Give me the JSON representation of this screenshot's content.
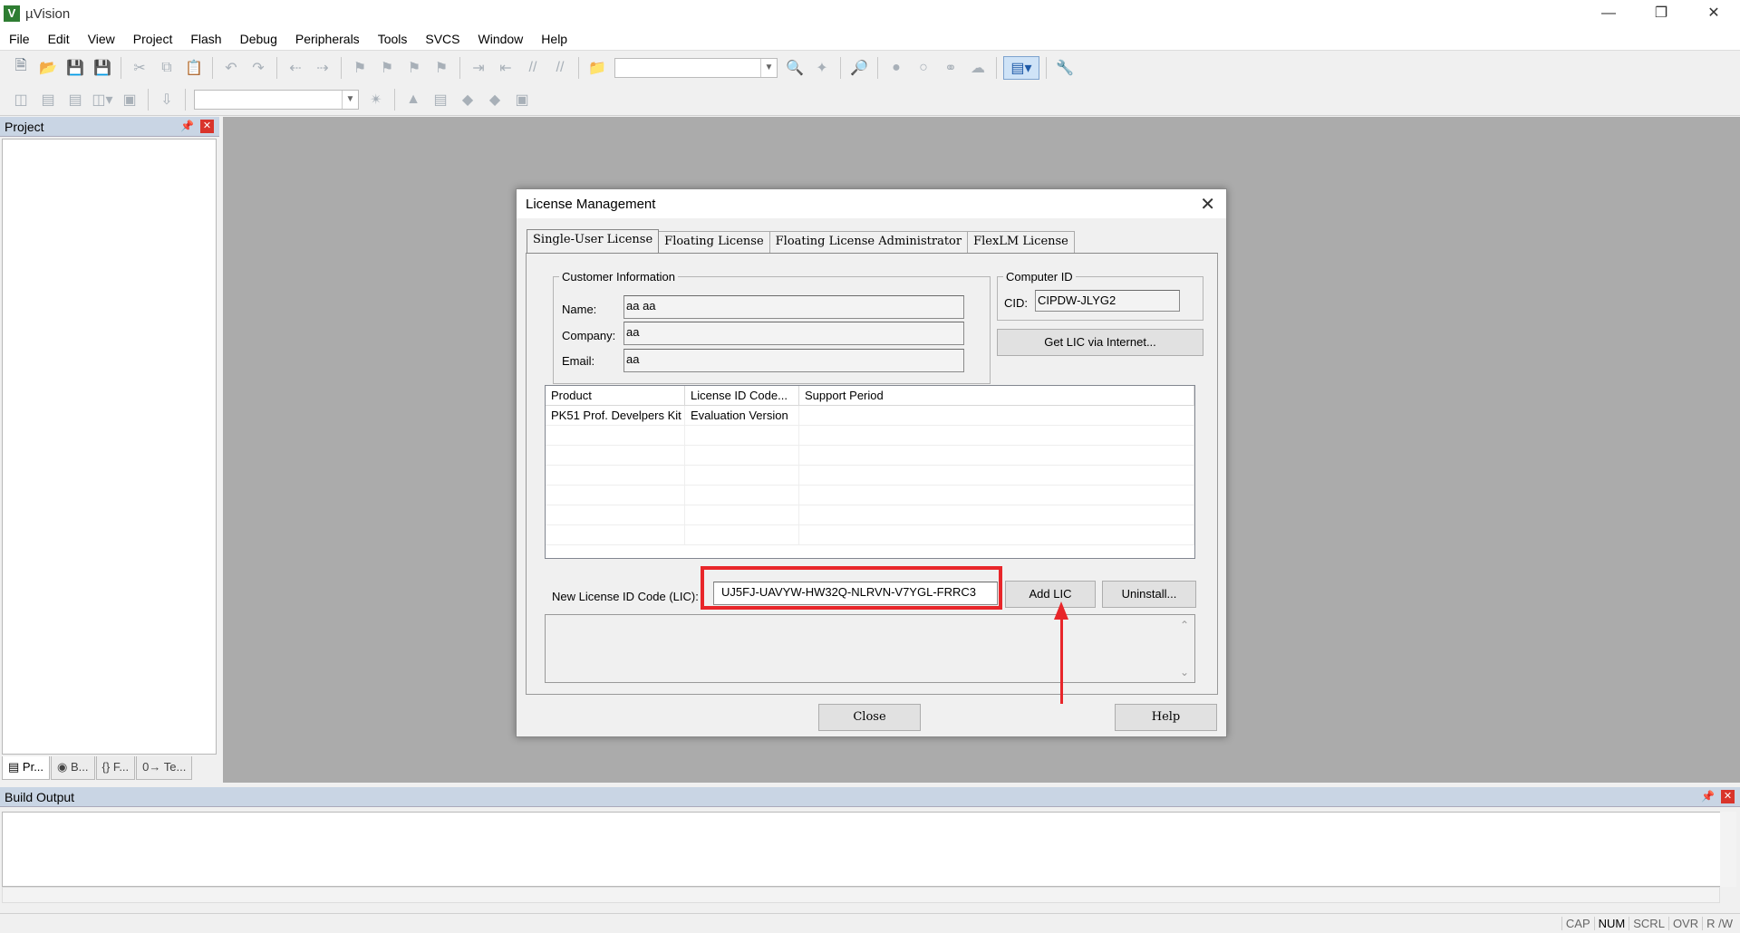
{
  "app": {
    "title": "µVision",
    "icon_label": "V"
  },
  "menu": [
    "File",
    "Edit",
    "View",
    "Project",
    "Flash",
    "Debug",
    "Peripherals",
    "Tools",
    "SVCS",
    "Window",
    "Help"
  ],
  "project_panel": {
    "title": "Project",
    "tabs": [
      "Pr...",
      "B...",
      "F...",
      "Te..."
    ]
  },
  "build_output": {
    "title": "Build Output"
  },
  "status_bar": {
    "cells": [
      "CAP",
      "NUM",
      "SCRL",
      "OVR",
      "R /W"
    ]
  },
  "dialog": {
    "title": "License Management",
    "tabs": [
      "Single-User License",
      "Floating License",
      "Floating License Administrator",
      "FlexLM License"
    ],
    "customer_info": {
      "legend": "Customer Information",
      "name_label": "Name:",
      "name_value": "aa aa",
      "company_label": "Company:",
      "company_value": "aa",
      "email_label": "Email:",
      "email_value": "aa"
    },
    "computer_id": {
      "legend": "Computer ID",
      "cid_label": "CID:",
      "cid_value": "CIPDW-JLYG2",
      "get_lic_button": "Get LIC via Internet..."
    },
    "products": {
      "columns": [
        "Product",
        "License ID Code...",
        "Support Period"
      ],
      "rows": [
        [
          "PK51 Prof. Develpers Kit",
          "Evaluation Version",
          ""
        ]
      ]
    },
    "new_lic": {
      "label": "New License ID Code (LIC):",
      "value": "UJ5FJ-UAVYW-HW32Q-NLRVN-V7YGL-FRRC3",
      "add_button": "Add LIC",
      "uninstall_button": "Uninstall..."
    },
    "close_button": "Close",
    "help_button": "Help"
  },
  "colors": {
    "annotation": "#e8262a",
    "panel_header": "#c9d5e4",
    "editor_bg": "#ababab"
  }
}
